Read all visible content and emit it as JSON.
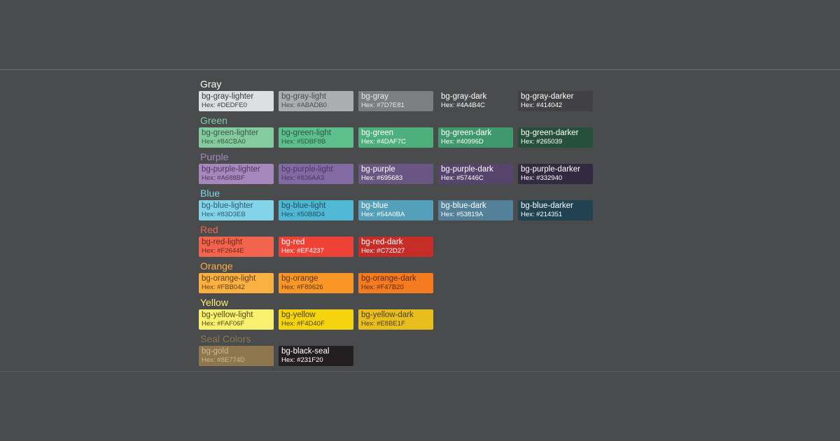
{
  "groups": [
    {
      "title": "Gray",
      "title_color": "#FFFFFF",
      "swatches": [
        {
          "name": "bg-gray-lighter",
          "hex": "Hex: #DEDFE0",
          "bg": "#DEDFE0",
          "fg": "#3A3B3C"
        },
        {
          "name": "bg-gray-light",
          "hex": "Hex: #ABADB0",
          "bg": "#ABADB0",
          "fg": "#4A4B4C"
        },
        {
          "name": "bg-gray",
          "hex": "Hex: #7D7E81",
          "bg": "#7D7E81",
          "fg": "#E8E8E8"
        },
        {
          "name": "bg-gray-dark",
          "hex": "Hex: #4A4B4C",
          "bg": "#4A4B4C",
          "fg": "#FFFFFF"
        },
        {
          "name": "bg-gray-darker",
          "hex": "Hex: #414042",
          "bg": "#414042",
          "fg": "#FFFFFF"
        }
      ]
    },
    {
      "title": "Green",
      "title_color": "#84CBA0",
      "swatches": [
        {
          "name": "bg-green-lighter",
          "hex": "Hex: #84CBA0",
          "bg": "#84CBA0",
          "fg": "#3A5A46"
        },
        {
          "name": "bg-green-light",
          "hex": "Hex: #5DBF8B",
          "bg": "#5DBF8B",
          "fg": "#2F5A42"
        },
        {
          "name": "bg-green",
          "hex": "Hex: #4DAF7C",
          "bg": "#4DAF7C",
          "fg": "#FFFFFF"
        },
        {
          "name": "bg-green-dark",
          "hex": "Hex: #40996D",
          "bg": "#40996D",
          "fg": "#FFFFFF"
        },
        {
          "name": "bg-green-darker",
          "hex": "Hex: #265039",
          "bg": "#265039",
          "fg": "#FFFFFF"
        }
      ]
    },
    {
      "title": "Purple",
      "title_color": "#A688BF",
      "swatches": [
        {
          "name": "bg-purple-lighter",
          "hex": "Hex: #A688BF",
          "bg": "#A688BF",
          "fg": "#4A3A58"
        },
        {
          "name": "bg-purple-light",
          "hex": "Hex: #836AA3",
          "bg": "#836AA3",
          "fg": "#4A3A5E"
        },
        {
          "name": "bg-purple",
          "hex": "Hex: #695683",
          "bg": "#695683",
          "fg": "#FFFFFF"
        },
        {
          "name": "bg-purple-dark",
          "hex": "Hex: #57446C",
          "bg": "#57446C",
          "fg": "#FFFFFF"
        },
        {
          "name": "bg-purple-darker",
          "hex": "Hex: #332940",
          "bg": "#332940",
          "fg": "#FFFFFF"
        }
      ]
    },
    {
      "title": "Blue",
      "title_color": "#83D3EB",
      "swatches": [
        {
          "name": "bg-blue-lighter",
          "hex": "Hex: #83D3EB",
          "bg": "#83D3EB",
          "fg": "#2F5A68"
        },
        {
          "name": "bg-blue-light",
          "hex": "Hex: #50B8D4",
          "bg": "#50B8D4",
          "fg": "#22505E"
        },
        {
          "name": "bg-blue",
          "hex": "Hex: #54A0BA",
          "bg": "#54A0BA",
          "fg": "#FFFFFF"
        },
        {
          "name": "bg-blue-dark",
          "hex": "Hex: #53819A",
          "bg": "#53819A",
          "fg": "#FFFFFF"
        },
        {
          "name": "bg-blue-darker",
          "hex": "Hex: #214351",
          "bg": "#214351",
          "fg": "#FFFFFF"
        }
      ]
    },
    {
      "title": "Red",
      "title_color": "#F2644E",
      "swatches": [
        {
          "name": "bg-red-light",
          "hex": "Hex: #F2644E",
          "bg": "#F2644E",
          "fg": "#6A2A1E"
        },
        {
          "name": "bg-red",
          "hex": "Hex: #EF4237",
          "bg": "#EF4237",
          "fg": "#FFFFFF"
        },
        {
          "name": "bg-red-dark",
          "hex": "Hex: #C72D27",
          "bg": "#C72D27",
          "fg": "#FFFFFF"
        }
      ]
    },
    {
      "title": "Orange",
      "title_color": "#FBB042",
      "swatches": [
        {
          "name": "bg-orange-light",
          "hex": "Hex: #FBB042",
          "bg": "#FBB042",
          "fg": "#5E3E12"
        },
        {
          "name": "bg-orange",
          "hex": "Hex: #F89626",
          "bg": "#F89626",
          "fg": "#5E3610"
        },
        {
          "name": "bg-orange-dark",
          "hex": "Hex: #F47B20",
          "bg": "#F47B20",
          "fg": "#5E2A08"
        }
      ]
    },
    {
      "title": "Yellow",
      "title_color": "#FAF06F",
      "swatches": [
        {
          "name": "bg-yellow-light",
          "hex": "Hex: #FAF06F",
          "bg": "#FAF06F",
          "fg": "#4E4A1A"
        },
        {
          "name": "bg-yellow",
          "hex": "Hex: #F4D40F",
          "bg": "#F4D40F",
          "fg": "#4E4406"
        },
        {
          "name": "bg-yellow-dark",
          "hex": "Hex: #E8BE1F",
          "bg": "#E8BE1F",
          "fg": "#4E3E08"
        }
      ]
    },
    {
      "title": "Seal Colors",
      "title_color": "#8E774D",
      "swatches": [
        {
          "name": "bg-gold",
          "hex": "Hex: #8E774D",
          "bg": "#8E774D",
          "fg": "#C9B895"
        },
        {
          "name": "bg-black-seal",
          "hex": "Hex: #231F20",
          "bg": "#231F20",
          "fg": "#FFFFFF"
        }
      ]
    }
  ]
}
